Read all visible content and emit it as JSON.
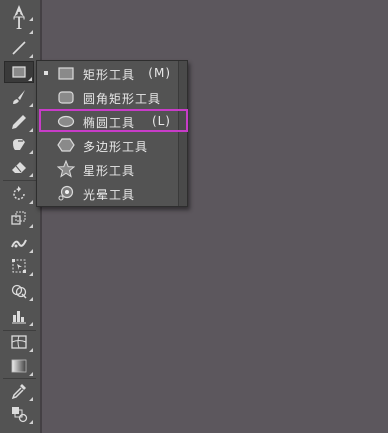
{
  "toolbar": {
    "tools": [
      {
        "name": "pen-tool",
        "icon": "pen-icon"
      },
      {
        "name": "type-tool",
        "icon": "type-icon",
        "glyph": "T"
      },
      {
        "name": "line-segment-tool",
        "icon": "line-icon"
      },
      {
        "name": "rectangle-tool",
        "icon": "rectangle-icon"
      },
      {
        "name": "paintbrush-tool",
        "icon": "brush-icon"
      },
      {
        "name": "pencil-tool",
        "icon": "pencil-icon"
      },
      {
        "name": "blob-brush-tool",
        "icon": "blob-brush-icon"
      },
      {
        "name": "eraser-tool",
        "icon": "eraser-icon"
      },
      {
        "name": "rotate-tool",
        "icon": "rotate-icon"
      },
      {
        "name": "scale-tool",
        "icon": "scale-icon"
      },
      {
        "name": "width-tool",
        "icon": "width-icon"
      },
      {
        "name": "free-transform-tool",
        "icon": "free-transform-icon"
      },
      {
        "name": "shape-builder-tool",
        "icon": "shape-builder-icon"
      },
      {
        "name": "graph-tool",
        "icon": "graph-icon"
      },
      {
        "name": "mesh-tool",
        "icon": "mesh-icon"
      },
      {
        "name": "gradient-tool",
        "icon": "gradient-icon"
      },
      {
        "name": "eyedropper-tool",
        "icon": "eyedropper-icon"
      },
      {
        "name": "blend-tool",
        "icon": "blend-icon"
      }
    ]
  },
  "flyout": {
    "items": [
      {
        "label": "矩形工具",
        "shortcut": "(M)",
        "icon": "rectangle-icon",
        "selected": true
      },
      {
        "label": "圆角矩形工具",
        "shortcut": "",
        "icon": "rounded-rectangle-icon",
        "selected": false
      },
      {
        "label": "椭圆工具",
        "shortcut": "(L)",
        "icon": "ellipse-icon",
        "selected": false
      },
      {
        "label": "多边形工具",
        "shortcut": "",
        "icon": "polygon-icon",
        "selected": false
      },
      {
        "label": "星形工具",
        "shortcut": "",
        "icon": "star-icon",
        "selected": false
      },
      {
        "label": "光晕工具",
        "shortcut": "",
        "icon": "flare-icon",
        "selected": false
      }
    ]
  },
  "colors": {
    "canvas": "#5c575d",
    "panel": "#535353",
    "highlight": "#c83cc8",
    "text": "#e8e8e8"
  }
}
